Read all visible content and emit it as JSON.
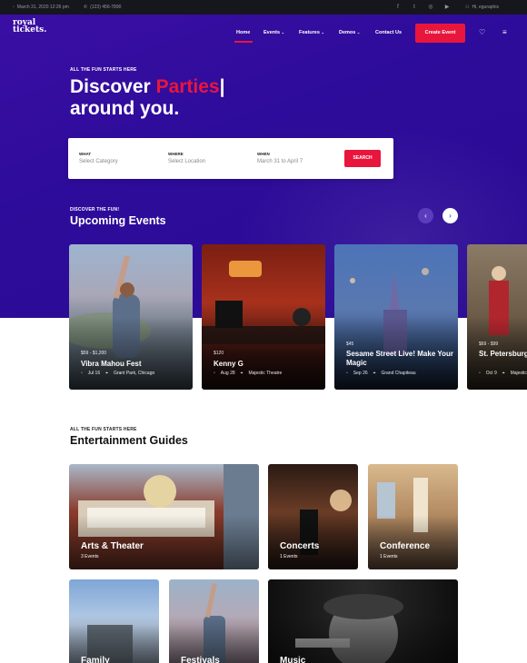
{
  "colors": {
    "brand_purple": "#2e0c9b",
    "accent_red": "#e8163c",
    "topbar_bg": "#16161d"
  },
  "topbar": {
    "datetime": "March 31, 2020 12:26 pm",
    "phone": "(123) 456-7890",
    "user_greeting": "Hi, eguraphis",
    "socials": [
      "facebook-icon",
      "twitter-icon",
      "instagram-icon",
      "youtube-icon"
    ]
  },
  "logo": {
    "line1": "royal",
    "line2": "tickets."
  },
  "nav": {
    "items": [
      "Home",
      "Events",
      "Features",
      "Demos",
      "Contact Us"
    ],
    "create_button": "Create Event"
  },
  "hero": {
    "eyebrow": "ALL THE FUN STARTS HERE",
    "title_part1": "Discover ",
    "title_accent": "Parties",
    "title_cursor": "|",
    "title_line2": "around you."
  },
  "search": {
    "what_label": "WHAT",
    "what_placeholder": "Select Category",
    "where_label": "WHERE",
    "where_placeholder": "Select Location",
    "when_label": "WHEN",
    "when_value": "March 31 to April 7",
    "button": "SEARCH"
  },
  "upcoming": {
    "eyebrow": "DISCOVER THE FUN!",
    "title": "Upcoming Events",
    "events": [
      {
        "price": "$59 - $1,200",
        "title": "Vibra Mahou Fest",
        "date": "Jul 16",
        "venue": "Grant Park, Chicago"
      },
      {
        "price": "$120",
        "title": "Kenny G",
        "date": "Aug 28",
        "venue": "Majestic Theatre"
      },
      {
        "price": "$45",
        "title": "Sesame Street Live! Make Your Magic",
        "date": "Sep 26",
        "venue": "Grand Chapiteau"
      },
      {
        "price": "$69 - $99",
        "title": "St. Petersburg Nutcracker",
        "date": "Oct 9",
        "venue": "Majestic"
      }
    ]
  },
  "guides": {
    "eyebrow": "ALL THE FUN STARTS HERE",
    "title": "Entertainment Guides",
    "items": [
      {
        "title": "Arts & Theater",
        "count": "3 Events"
      },
      {
        "title": "Concerts",
        "count": "1 Events"
      },
      {
        "title": "Conference",
        "count": "1 Events"
      },
      {
        "title": "Family",
        "count": ""
      },
      {
        "title": "Festivals",
        "count": ""
      },
      {
        "title": "Music",
        "count": ""
      }
    ]
  }
}
